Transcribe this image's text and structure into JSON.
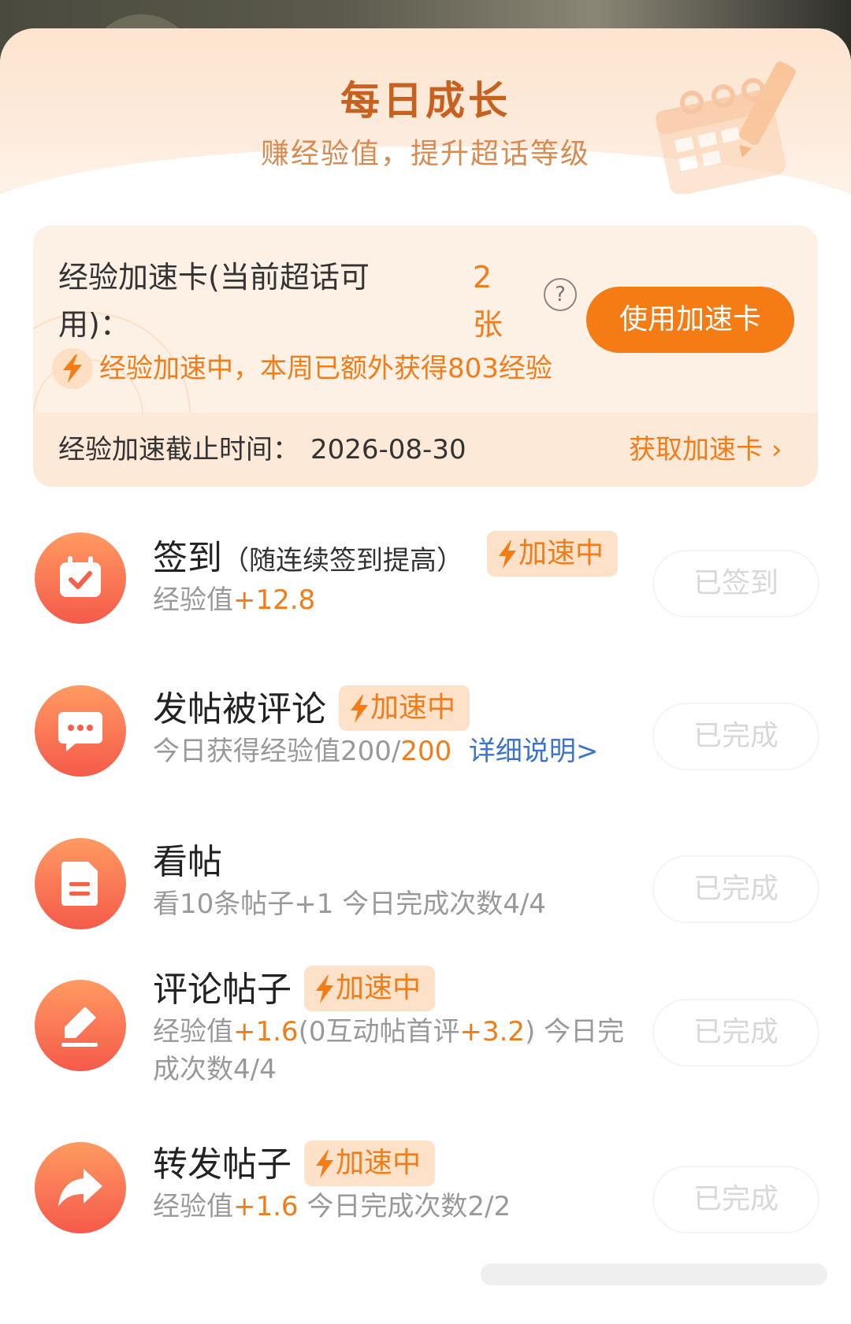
{
  "header": {
    "title": "每日成长",
    "subtitle": "赚经验值，提升超话等级"
  },
  "boost_card": {
    "label_line1": "经验加速卡(当前超话可",
    "label_line2": "用)：",
    "count_value": "2",
    "count_unit": "张",
    "help_symbol": "?",
    "use_button": "使用加速卡",
    "status": "经验加速中，本周已额外获得803经验",
    "deadline_label": "经验加速截止时间：",
    "deadline_date": "2026-08-30",
    "get_card_link": "获取加速卡",
    "get_card_chevron": "›"
  },
  "badge_label": "加速中",
  "tasks": [
    {
      "icon": "calendar-check-icon",
      "title": "签到",
      "title_note": "（随连续签到提高）",
      "desc_prefix": "经验值",
      "desc_value": "+12.8",
      "button": "已签到"
    },
    {
      "icon": "chat-bubble-icon",
      "title": "发帖被评论",
      "desc_prefix": "今日获得经验值200/",
      "desc_value": "200",
      "desc_link": "详细说明>",
      "button": "已完成"
    },
    {
      "icon": "document-icon",
      "title": "看帖",
      "desc": "看10条帖子+1  今日完成次数4/4",
      "button": "已完成"
    },
    {
      "icon": "pencil-icon",
      "title": "评论帖子",
      "desc_prefix": "经验值",
      "desc_value": "+1.6",
      "desc_mid": "(0互动帖首评",
      "desc_value2": "+3.2",
      "desc_suffix_line1": ")  今日完",
      "desc_line2": "成次数4/4",
      "button": "已完成"
    },
    {
      "icon": "share-arrow-icon",
      "title": "转发帖子",
      "desc_prefix": "经验值",
      "desc_value": "+1.6",
      "desc_suffix": "  今日完成次数2/2",
      "button": "已完成"
    }
  ],
  "colors": {
    "accent": "#f57b14",
    "title": "#c8611f",
    "icon_gradient_top": "#ff9a62",
    "icon_gradient_bottom": "#f55a4a",
    "link": "#3d74c9"
  }
}
